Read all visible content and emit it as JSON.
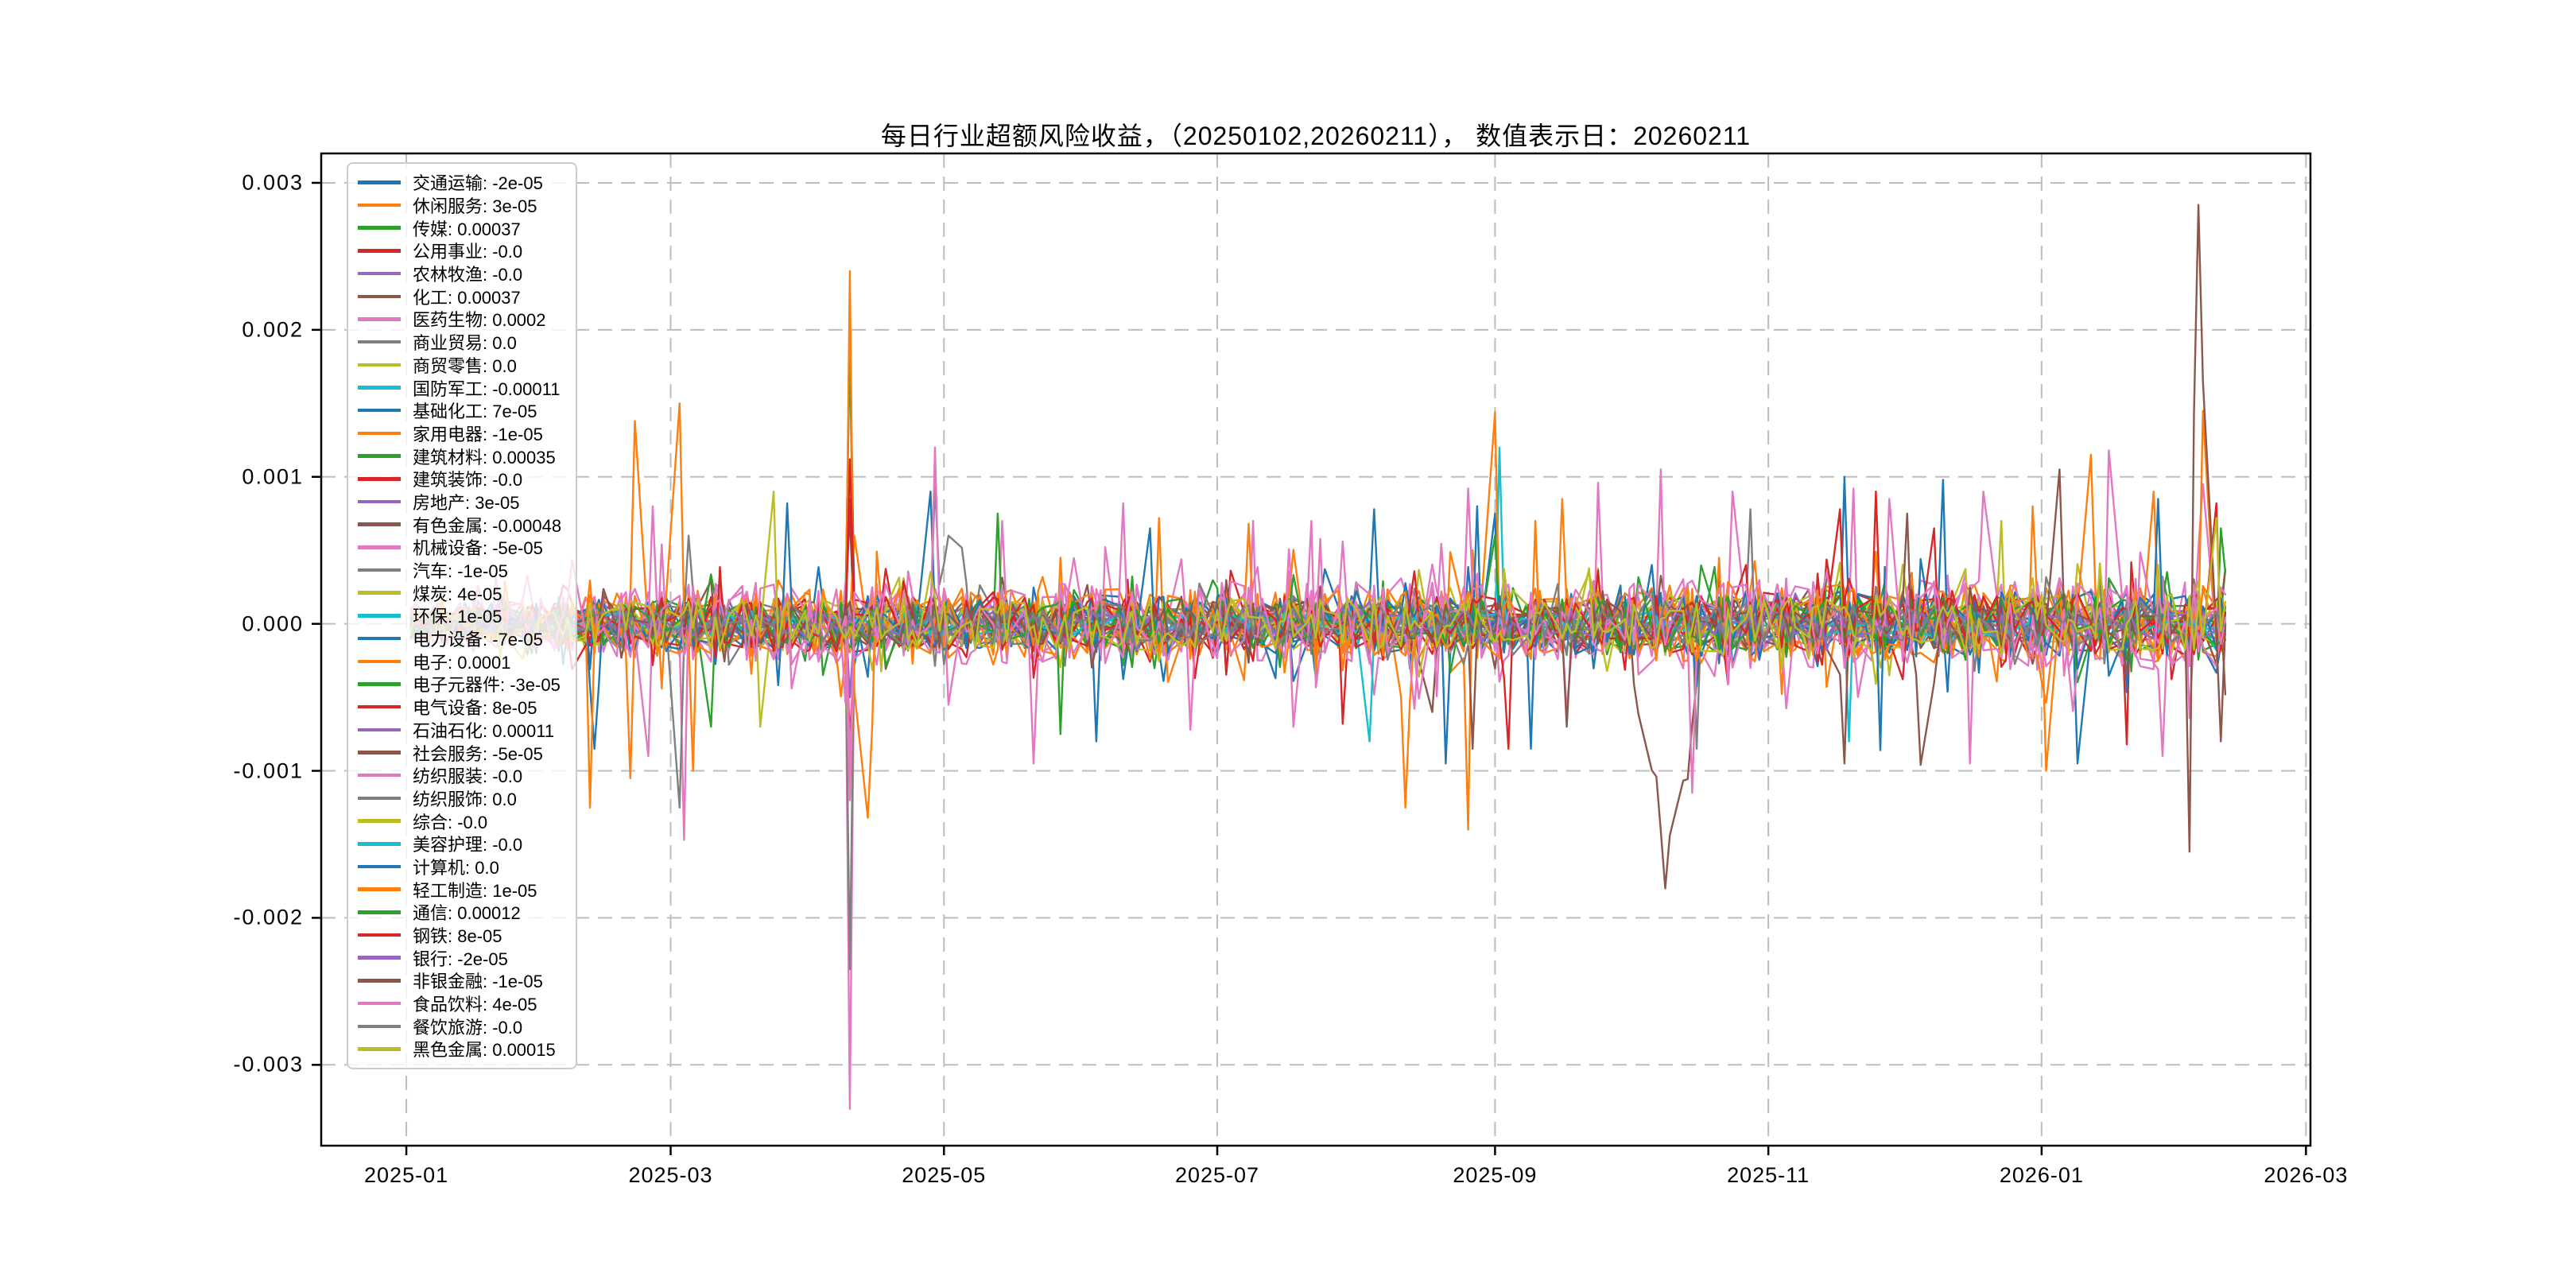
{
  "chart_data": {
    "type": "line",
    "title": "每日行业超额风险收益，（20250102,20260211）， 数值表示日：20260211",
    "value_label_date": "20260211",
    "grid": true,
    "legend_position": "upper-left",
    "legend_separator": ": ",
    "ylim": [
      -0.00355,
      0.0032
    ],
    "x_range": [
      "2024-12-13",
      "2026-03-02"
    ],
    "data_date_range": [
      "2025-01-02",
      "2026-02-11"
    ],
    "x_ticks": [
      {
        "label": "2025-01",
        "date": "2025-01-01"
      },
      {
        "label": "2025-03",
        "date": "2025-03-01"
      },
      {
        "label": "2025-05",
        "date": "2025-05-01"
      },
      {
        "label": "2025-07",
        "date": "2025-07-01"
      },
      {
        "label": "2025-09",
        "date": "2025-09-01"
      },
      {
        "label": "2025-11",
        "date": "2025-11-01"
      },
      {
        "label": "2026-01",
        "date": "2026-01-01"
      },
      {
        "label": "2026-03",
        "date": "2026-03-01"
      }
    ],
    "y_ticks": [
      {
        "label": "0.003",
        "value": 0.003
      },
      {
        "label": "0.002",
        "value": 0.002
      },
      {
        "label": "0.001",
        "value": 0.001
      },
      {
        "label": "0.000",
        "value": 0.0
      },
      {
        "label": "-0.001",
        "value": -0.001
      },
      {
        "label": "-0.002",
        "value": -0.002
      },
      {
        "label": "-0.003",
        "value": -0.003
      }
    ],
    "series": [
      {
        "name": "交通运输",
        "value_label": "-2e-05",
        "color": "#1f77b4",
        "noise_amp": 0.0002
      },
      {
        "name": "休闲服务",
        "value_label": "3e-05",
        "color": "#ff7f0e",
        "noise_amp": 0.00024
      },
      {
        "name": "传媒",
        "value_label": "0.00037",
        "color": "#2ca02c",
        "noise_amp": 0.00017
      },
      {
        "name": "公用事业",
        "value_label": "-0.0",
        "color": "#d62728",
        "noise_amp": 0.00019
      },
      {
        "name": "农林牧渔",
        "value_label": "-0.0",
        "color": "#9467bd",
        "noise_amp": 9e-05
      },
      {
        "name": "化工",
        "value_label": "0.00037",
        "color": "#8c564b",
        "noise_amp": 0.00015
      },
      {
        "name": "医药生物",
        "value_label": "0.0002",
        "color": "#e377c2",
        "noise_amp": 0.00028
      },
      {
        "name": "商业贸易",
        "value_label": "0.0",
        "color": "#7f7f7f",
        "noise_amp": 0.00014
      },
      {
        "name": "商贸零售",
        "value_label": "0.0",
        "color": "#bcbd22",
        "noise_amp": 0.00018
      },
      {
        "name": "国防军工",
        "value_label": "-0.00011",
        "color": "#17becf",
        "noise_amp": 9e-05
      },
      {
        "name": "基础化工",
        "value_label": "7e-05",
        "color": "#1f77b4",
        "noise_amp": 0.0002
      },
      {
        "name": "家用电器",
        "value_label": "-1e-05",
        "color": "#ff7f0e",
        "noise_amp": 0.00024
      },
      {
        "name": "建筑材料",
        "value_label": "0.00035",
        "color": "#2ca02c",
        "noise_amp": 0.00017
      },
      {
        "name": "建筑装饰",
        "value_label": "-0.0",
        "color": "#d62728",
        "noise_amp": 0.00019
      },
      {
        "name": "房地产",
        "value_label": "3e-05",
        "color": "#9467bd",
        "noise_amp": 9e-05
      },
      {
        "name": "有色金属",
        "value_label": "-0.00048",
        "color": "#8c564b",
        "noise_amp": 0.00015
      },
      {
        "name": "机械设备",
        "value_label": "-5e-05",
        "color": "#e377c2",
        "noise_amp": 0.00028
      },
      {
        "name": "汽车",
        "value_label": "-1e-05",
        "color": "#7f7f7f",
        "noise_amp": 0.00014
      },
      {
        "name": "煤炭",
        "value_label": "4e-05",
        "color": "#bcbd22",
        "noise_amp": 0.00018
      },
      {
        "name": "环保",
        "value_label": "1e-05",
        "color": "#17becf",
        "noise_amp": 8e-05
      },
      {
        "name": "电力设备",
        "value_label": "-7e-05",
        "color": "#1f77b4",
        "noise_amp": 0.0002
      },
      {
        "name": "电子",
        "value_label": "0.0001",
        "color": "#ff7f0e",
        "noise_amp": 0.00024
      },
      {
        "name": "电子元器件",
        "value_label": "-3e-05",
        "color": "#2ca02c",
        "noise_amp": 0.00017
      },
      {
        "name": "电气设备",
        "value_label": "8e-05",
        "color": "#d62728",
        "noise_amp": 0.00019
      },
      {
        "name": "石油石化",
        "value_label": "0.00011",
        "color": "#9467bd",
        "noise_amp": 9e-05
      },
      {
        "name": "社会服务",
        "value_label": "-5e-05",
        "color": "#8c564b",
        "noise_amp": 0.00015
      },
      {
        "name": "纺织服装",
        "value_label": "-0.0",
        "color": "#e377c2",
        "noise_amp": 0.00028
      },
      {
        "name": "纺织服饰",
        "value_label": "0.0",
        "color": "#7f7f7f",
        "noise_amp": 0.00014
      },
      {
        "name": "综合",
        "value_label": "-0.0",
        "color": "#bcbd22",
        "noise_amp": 0.00018
      },
      {
        "name": "美容护理",
        "value_label": "-0.0",
        "color": "#17becf",
        "noise_amp": 8e-05
      },
      {
        "name": "计算机",
        "value_label": "0.0",
        "color": "#1f77b4",
        "noise_amp": 0.0002
      },
      {
        "name": "轻工制造",
        "value_label": "1e-05",
        "color": "#ff7f0e",
        "noise_amp": 0.00024
      },
      {
        "name": "通信",
        "value_label": "0.00012",
        "color": "#2ca02c",
        "noise_amp": 0.00017
      },
      {
        "name": "钢铁",
        "value_label": "8e-05",
        "color": "#d62728",
        "noise_amp": 0.00019
      },
      {
        "name": "银行",
        "value_label": "-2e-05",
        "color": "#9467bd",
        "noise_amp": 9e-05
      },
      {
        "name": "非银金融",
        "value_label": "-1e-05",
        "color": "#8c564b",
        "noise_amp": 0.00015
      },
      {
        "name": "食品饮料",
        "value_label": "4e-05",
        "color": "#e377c2",
        "noise_amp": 0.00028
      },
      {
        "name": "餐饮旅游",
        "value_label": "-0.0",
        "color": "#7f7f7f",
        "noise_amp": 0.00014
      },
      {
        "name": "黑色金属",
        "value_label": "0.00015",
        "color": "#bcbd22",
        "noise_amp": 0.00018
      }
    ],
    "events": [
      [
        10,
        "2025-02-12",
        -0.00085,
        2
      ],
      [
        11,
        "2025-02-11",
        -0.00125,
        1
      ],
      [
        31,
        "2025-02-20",
        -0.00105,
        1
      ],
      [
        1,
        "2025-02-21",
        0.00138,
        1
      ],
      [
        6,
        "2025-02-24",
        -0.0009,
        1
      ],
      [
        16,
        "2025-02-25",
        0.0008,
        1
      ],
      [
        21,
        "2025-03-03",
        0.0015,
        1
      ],
      [
        17,
        "2025-03-03",
        -0.00125,
        1
      ],
      [
        16,
        "2025-03-04",
        -0.00147,
        1
      ],
      [
        31,
        "2025-03-06",
        -0.001,
        1
      ],
      [
        7,
        "2025-03-05",
        0.0006,
        2
      ],
      [
        2,
        "2025-03-10",
        -0.0007,
        1
      ],
      [
        38,
        "2025-03-24",
        0.0009,
        1
      ],
      [
        8,
        "2025-03-21",
        -0.0007,
        1
      ],
      [
        30,
        "2025-03-27",
        0.00082,
        1
      ],
      [
        21,
        "2025-04-10",
        0.0024,
        1
      ],
      [
        0,
        "2025-04-10",
        0.00205,
        1
      ],
      [
        2,
        "2025-04-10",
        0.0019,
        1
      ],
      [
        23,
        "2025-04-10",
        0.00112,
        1
      ],
      [
        33,
        "2025-04-10",
        0.00085,
        1
      ],
      [
        5,
        "2025-04-10",
        0.00075,
        1
      ],
      [
        6,
        "2025-04-10",
        -0.0033,
        1
      ],
      [
        7,
        "2025-04-10",
        -0.00235,
        1
      ],
      [
        8,
        "2025-04-10",
        -0.00118,
        1
      ],
      [
        36,
        "2025-04-10",
        -0.0012,
        1
      ],
      [
        16,
        "2025-04-10",
        -0.00095,
        1
      ],
      [
        13,
        "2025-04-10",
        -0.0008,
        1
      ],
      [
        4,
        "2025-04-10",
        -0.0005,
        1
      ],
      [
        21,
        "2025-04-14",
        -0.00132,
        2
      ],
      [
        11,
        "2025-04-11",
        0.0006,
        1
      ],
      [
        36,
        "2025-04-29",
        0.0012,
        1
      ],
      [
        17,
        "2025-04-29",
        0.00095,
        1
      ],
      [
        20,
        "2025-04-28",
        0.0009,
        1
      ],
      [
        17,
        "2025-05-02",
        0.0006,
        3
      ],
      [
        6,
        "2025-05-14",
        0.0007,
        1
      ],
      [
        36,
        "2025-05-21",
        -0.00095,
        1
      ],
      [
        12,
        "2025-05-13",
        0.00075,
        1
      ],
      [
        22,
        "2025-05-27",
        -0.00075,
        1
      ],
      [
        26,
        "2025-06-10",
        0.00082,
        1
      ],
      [
        10,
        "2025-06-04",
        -0.0008,
        1
      ],
      [
        30,
        "2025-06-16",
        0.00065,
        1
      ],
      [
        1,
        "2025-06-18",
        0.00072,
        1
      ],
      [
        36,
        "2025-06-25",
        -0.00072,
        1
      ],
      [
        6,
        "2025-07-09",
        0.0007,
        1
      ],
      [
        26,
        "2025-07-18",
        -0.0007,
        1
      ],
      [
        11,
        "2025-07-08",
        0.00068,
        1
      ],
      [
        16,
        "2025-07-22",
        0.0007,
        1
      ],
      [
        3,
        "2025-07-29",
        -0.00068,
        1
      ],
      [
        9,
        "2025-08-04",
        -0.0008,
        1
      ],
      [
        0,
        "2025-08-05",
        0.00078,
        1
      ],
      [
        11,
        "2025-08-12",
        -0.00125,
        2
      ],
      [
        15,
        "2025-08-18",
        -0.0006,
        2
      ],
      [
        10,
        "2025-08-21",
        -0.00095,
        1
      ],
      [
        1,
        "2025-08-26",
        -0.0014,
        1
      ],
      [
        36,
        "2025-08-26",
        0.00092,
        1
      ],
      [
        25,
        "2025-08-27",
        -0.00085,
        1
      ],
      [
        30,
        "2025-08-28",
        0.0008,
        1
      ],
      [
        11,
        "2025-09-01",
        0.00144,
        1
      ],
      [
        9,
        "2025-09-02",
        0.0012,
        1
      ],
      [
        0,
        "2025-09-01",
        0.00075,
        1
      ],
      [
        12,
        "2025-09-01",
        0.0006,
        1
      ],
      [
        33,
        "2025-09-04",
        -0.00085,
        1
      ],
      [
        10,
        "2025-09-09",
        -0.00085,
        1
      ],
      [
        21,
        "2025-09-10",
        0.0007,
        1
      ],
      [
        1,
        "2025-09-16",
        0.00085,
        1
      ],
      [
        6,
        "2025-09-24",
        0.00096,
        1
      ],
      [
        35,
        "2025-09-17",
        -0.0007,
        1
      ],
      [
        15,
        "2025-10-09",
        -0.0018,
        6
      ],
      [
        6,
        "2025-10-08",
        0.00105,
        1
      ],
      [
        26,
        "2025-10-15",
        -0.00115,
        1
      ],
      [
        7,
        "2025-10-16",
        -0.00085,
        1
      ],
      [
        16,
        "2025-10-24",
        0.0009,
        1
      ],
      [
        17,
        "2025-10-28",
        0.00078,
        1
      ],
      [
        33,
        "2025-11-17",
        0.00078,
        1
      ],
      [
        15,
        "2025-11-18",
        -0.00095,
        1
      ],
      [
        9,
        "2025-11-19",
        -0.0008,
        1
      ],
      [
        10,
        "2025-11-18",
        0.001,
        1
      ],
      [
        6,
        "2025-11-20",
        0.00092,
        1
      ],
      [
        23,
        "2025-11-25",
        0.0009,
        1
      ],
      [
        30,
        "2025-11-26",
        -0.00086,
        1
      ],
      [
        36,
        "2025-11-28",
        0.00085,
        1
      ],
      [
        35,
        "2025-12-02",
        0.00075,
        1
      ],
      [
        33,
        "2025-12-08",
        0.00065,
        1
      ],
      [
        35,
        "2025-12-05",
        -0.00096,
        2
      ],
      [
        20,
        "2025-12-10",
        0.00098,
        1
      ],
      [
        16,
        "2025-12-16",
        -0.00095,
        1
      ],
      [
        26,
        "2025-12-19",
        0.0009,
        1
      ],
      [
        8,
        "2025-12-23",
        0.0007,
        1
      ],
      [
        1,
        "2025-12-30",
        0.0008,
        1
      ],
      [
        11,
        "2026-01-02",
        -0.001,
        1
      ],
      [
        35,
        "2026-01-05",
        0.00105,
        1
      ],
      [
        10,
        "2026-01-09",
        -0.00095,
        1
      ],
      [
        31,
        "2026-01-12",
        0.00115,
        1
      ],
      [
        36,
        "2026-01-16",
        0.00118,
        1
      ],
      [
        3,
        "2026-01-20",
        -0.00082,
        1
      ],
      [
        30,
        "2026-01-27",
        0.00085,
        1
      ],
      [
        21,
        "2026-01-26",
        0.0009,
        1
      ],
      [
        16,
        "2026-01-28",
        -0.0009,
        1
      ],
      [
        35,
        "2026-02-03",
        -0.00155,
        1
      ],
      [
        35,
        "2026-02-05",
        0.00285,
        2
      ],
      [
        21,
        "2026-02-06",
        0.00145,
        1
      ],
      [
        6,
        "2026-02-06",
        0.00095,
        1
      ],
      [
        33,
        "2026-02-09",
        0.00082,
        1
      ],
      [
        38,
        "2026-02-09",
        0.00072,
        1
      ],
      [
        12,
        "2026-02-10",
        0.00065,
        1
      ],
      [
        35,
        "2026-02-10",
        -0.0008,
        1
      ]
    ],
    "noise_envelope": [
      [
        0,
        0.45
      ],
      [
        0.1,
        0.85
      ],
      [
        0.17,
        1.0
      ],
      [
        0.62,
        1.0
      ],
      [
        0.7,
        1.12
      ],
      [
        1,
        1.12
      ]
    ],
    "seed": 12,
    "style": {
      "background": "#ffffff",
      "spine_color": "#000000",
      "grid_color": "#bdbdbd",
      "tick_color": "#000000",
      "legend_border_color": "#cccccc"
    }
  }
}
